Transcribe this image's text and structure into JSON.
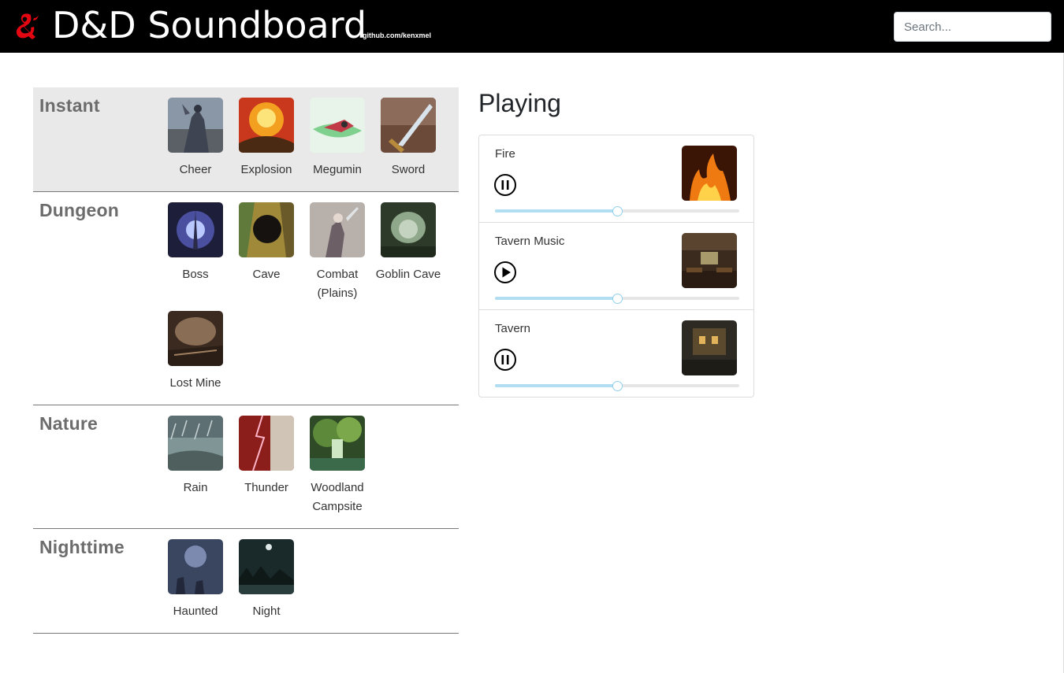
{
  "header": {
    "title": "D&D Soundboard",
    "github": "github.com/kenxmel",
    "search_placeholder": "Search...",
    "logo_icon": "dnd-ampersand-dragon-icon",
    "logo_color": "#e40712"
  },
  "categories": [
    {
      "title": "Instant",
      "highlight": true,
      "sounds": [
        {
          "label": "Cheer",
          "art": "cheer"
        },
        {
          "label": "Explosion",
          "art": "explosion"
        },
        {
          "label": "Megumin",
          "art": "megumin"
        },
        {
          "label": "Sword",
          "art": "sword"
        }
      ]
    },
    {
      "title": "Dungeon",
      "highlight": false,
      "sounds": [
        {
          "label": "Boss",
          "art": "boss"
        },
        {
          "label": "Cave",
          "art": "cave"
        },
        {
          "label": "Combat (Plains)",
          "art": "combat"
        },
        {
          "label": "Goblin Cave",
          "art": "goblin"
        },
        {
          "label": "Lost Mine",
          "art": "mine"
        }
      ]
    },
    {
      "title": "Nature",
      "highlight": false,
      "sounds": [
        {
          "label": "Rain",
          "art": "rain"
        },
        {
          "label": "Thunder",
          "art": "thunder"
        },
        {
          "label": "Woodland Campsite",
          "art": "woodland"
        }
      ]
    },
    {
      "title": "Nighttime",
      "highlight": false,
      "sounds": [
        {
          "label": "Haunted",
          "art": "haunted"
        },
        {
          "label": "Night",
          "art": "night"
        }
      ]
    }
  ],
  "playing": {
    "title": "Playing",
    "tracks": [
      {
        "name": "Fire",
        "state": "playing",
        "button_icon": "pause-icon",
        "volume": 0.5,
        "art": "fire"
      },
      {
        "name": "Tavern Music",
        "state": "paused",
        "button_icon": "play-icon",
        "volume": 0.5,
        "art": "tavernmusic"
      },
      {
        "name": "Tavern",
        "state": "playing",
        "button_icon": "pause-icon",
        "volume": 0.5,
        "art": "tavern"
      }
    ]
  },
  "colors": {
    "header_bg": "#000000",
    "highlight_bg": "#e9e9e9",
    "volume_fill": "#b1def0",
    "category_text": "#6c6c6c"
  }
}
